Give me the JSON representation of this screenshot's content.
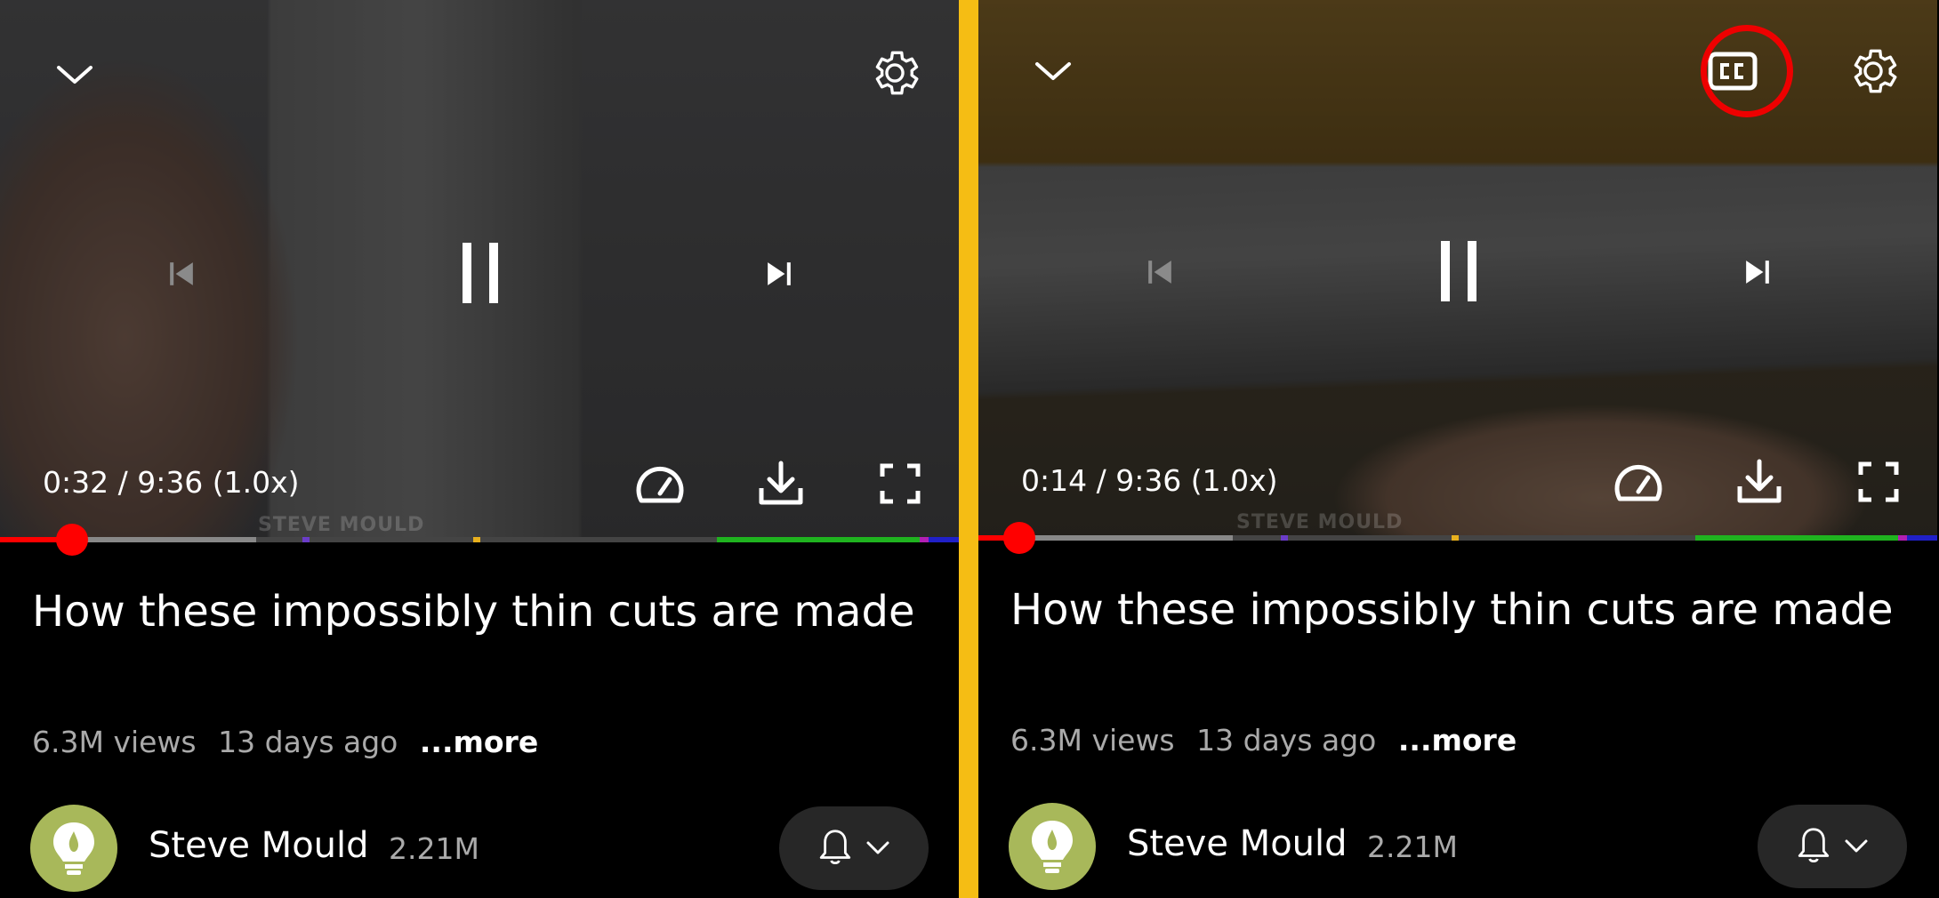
{
  "panels": [
    {
      "id": "left",
      "time": "0:32 / 9:36 (1.0x)",
      "progress_fraction": 0.055,
      "watermark": "STEVE MOULD",
      "title": "How these impossibly thin cuts are made",
      "views": "6.3M views",
      "age": "13 days ago",
      "more_label": "...more",
      "channel_name": "Steve Mould",
      "subscribers": "2.21M",
      "has_cc_button": false
    },
    {
      "id": "right",
      "time": "0:14 / 9:36 (1.0x)",
      "progress_fraction": 0.022,
      "watermark": "STEVE MOULD",
      "title": "How these impossibly thin cuts are made",
      "views": "6.3M views",
      "age": "13 days ago",
      "more_label": "...more",
      "channel_name": "Steve Mould",
      "subscribers": "2.21M",
      "has_cc_button": true,
      "cc_highlighted": true
    }
  ],
  "icons": {
    "collapse": "chevron-down-icon",
    "settings": "gear-icon",
    "captions": "closed-captions-icon",
    "previous": "skip-previous-icon",
    "pause": "pause-icon",
    "next": "skip-next-icon",
    "speed": "speedometer-icon",
    "download": "download-icon",
    "fullscreen": "fullscreen-icon",
    "bell": "bell-icon",
    "dropdown": "chevron-down-icon"
  },
  "colors": {
    "progress_played": "#ff0000",
    "divider": "#f5bd14",
    "highlight_ring": "#ee0000",
    "avatar_bg": "#a8b85a"
  }
}
